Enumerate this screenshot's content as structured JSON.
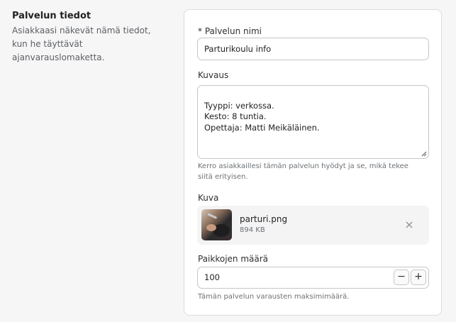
{
  "section": {
    "title": "Palvelun tiedot",
    "description": "Asiakkaasi näkevät nämä tiedot, kun he täyttävät ajanvarauslomaketta."
  },
  "form": {
    "name": {
      "label": "* Palvelun nimi",
      "value": "Parturikoulu info"
    },
    "description": {
      "label": "Kuvaus",
      "value": "Tyyppi: verkossa.\nKesto: 8 tuntia.\nOpettaja: Matti Meikäläinen.",
      "help": "Kerro asiakkaillesi tämän palvelun hyödyt ja se, mikä tekee siitä erityisen."
    },
    "image": {
      "label": "Kuva",
      "file_name": "parturi.png",
      "file_size": "894 KB"
    },
    "capacity": {
      "label": "Paikkojen määrä",
      "value": "100",
      "minus": "−",
      "plus": "+",
      "help": "Tämän palvelun varausten maksimimäärä."
    }
  },
  "icons": {
    "remove": "close-icon",
    "resize": "resize-grip-icon"
  }
}
